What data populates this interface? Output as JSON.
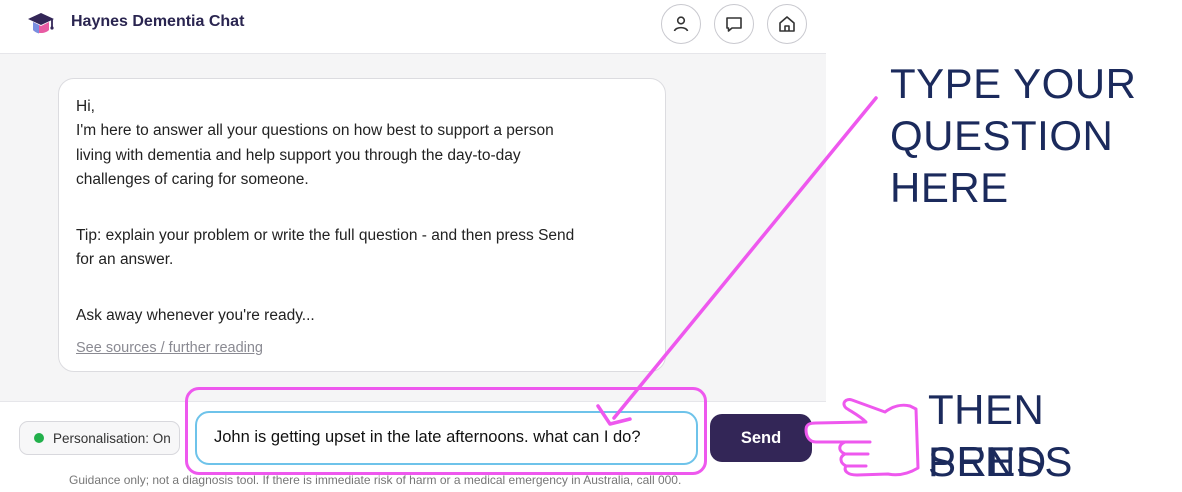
{
  "header": {
    "title": "Haynes Dementia Chat",
    "buttons": [
      {
        "name": "profile-button",
        "icon": "user-icon"
      },
      {
        "name": "chat-button",
        "icon": "chat-bubble-icon"
      },
      {
        "name": "home-button",
        "icon": "home-icon"
      }
    ]
  },
  "bot_message": {
    "lines": [
      "Hi,",
      "I'm here to answer all your questions on how best to support a person",
      "living with dementia and help support you through the day-to-day",
      "challenges of caring for someone.",
      "Tip: explain your problem or write the full question - and then press Send",
      "for an answer.",
      "Ask away whenever you're ready..."
    ],
    "sources_link": "See sources / further reading"
  },
  "composer": {
    "personalisation_label": "Personalisation: On",
    "input_value": "John is getting upset in the late afternoons. what can I do?",
    "send_label": "Send",
    "disclaimer": "Guidance only; not a diagnosis tool. If there is immediate risk of harm or a medical emergency in Australia, call 000."
  },
  "annotations": {
    "type_question": [
      "TYPE YOUR",
      "QUESTION",
      "HERE"
    ],
    "press_send": [
      "THEN PRESS",
      "SEND"
    ]
  },
  "colors": {
    "accent_dark": "#332657",
    "input_border": "#6ec3ea",
    "highlight": "#ee58ee",
    "annotation_text": "#1b2a5c",
    "status_on": "#22b04b"
  }
}
